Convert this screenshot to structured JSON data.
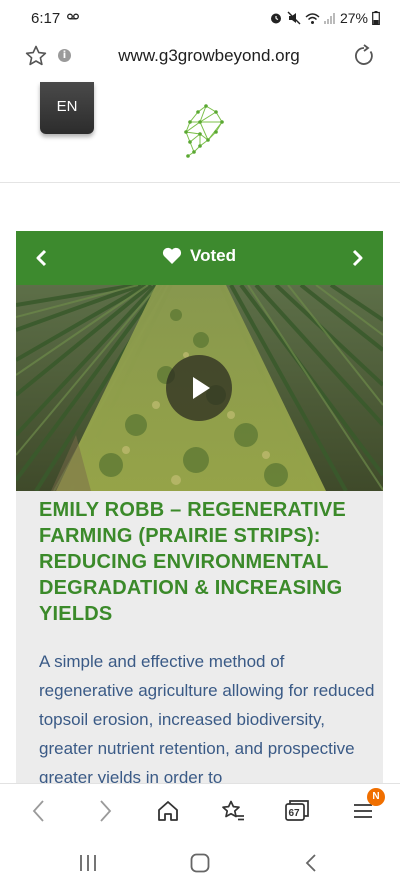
{
  "status_bar": {
    "time": "6:17",
    "battery_text": "27%"
  },
  "browser": {
    "url": "www.g3growbeyond.org",
    "info_glyph": "i",
    "tab_count": "67",
    "menu_badge": "N"
  },
  "site_header": {
    "lang_label": "EN"
  },
  "card": {
    "vote_label": "Voted",
    "title": "EMILY ROBB – REGENERATIVE FARMING (PRAIRIE STRIPS): REDUCING ENVIRONMENTAL DEGRADATION & INCREASING YIELDS",
    "description": "A simple and effective method of regenerative agriculture allowing for reduced topsoil erosion, increased biodiversity, greater nutrient retention, and prospective greater yields in order to"
  },
  "colors": {
    "accent_green": "#3d8a2e",
    "title_green": "#3b8a2a",
    "description_blue": "#3a5a86",
    "badge_orange": "#f06f00"
  },
  "icons": [
    "voicemail-icon",
    "alarm-icon",
    "mute-icon",
    "wifi-icon",
    "signal-icon",
    "battery-icon",
    "bookmark-star-icon",
    "info-icon",
    "reload-icon",
    "chevron-left-icon",
    "chevron-right-icon",
    "heart-icon",
    "play-icon",
    "back-icon",
    "forward-icon",
    "home-icon",
    "bookmarks-icon",
    "tabs-icon",
    "menu-icon",
    "recents-icon",
    "home-button-icon",
    "system-back-icon"
  ]
}
